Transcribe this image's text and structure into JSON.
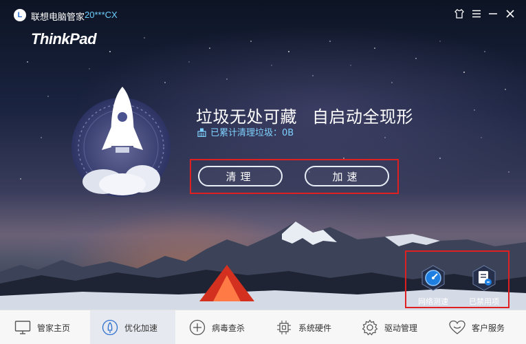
{
  "window": {
    "app_name": "联想电脑管家",
    "device_model": "20***CX",
    "brand": "ThinkPad",
    "logo_letter": "L",
    "controls": [
      "skin-icon",
      "menu-icon",
      "minimize-icon",
      "close-icon"
    ]
  },
  "hero": {
    "headline_part1": "垃圾无处可藏",
    "headline_part2": "自启动全现形",
    "status_text": "已累计清理垃圾：0B"
  },
  "actions": {
    "clean_label": "清理",
    "speedup_label": "加速"
  },
  "tools": [
    {
      "label": "网络测速",
      "icon": "speedometer-icon"
    },
    {
      "label": "已禁用项",
      "icon": "disabled-list-icon"
    }
  ],
  "nav": {
    "active_index": 1,
    "items": [
      {
        "label": "管家主页",
        "icon": "monitor-icon"
      },
      {
        "label": "优化加速",
        "icon": "rocket-icon"
      },
      {
        "label": "病毒查杀",
        "icon": "shield-icon"
      },
      {
        "label": "系统硬件",
        "icon": "chip-icon"
      },
      {
        "label": "驱动管理",
        "icon": "gear-icon"
      },
      {
        "label": "客户服务",
        "icon": "heart-icon"
      }
    ]
  },
  "colors": {
    "accent_cyan": "#6fd0ff",
    "highlight_red": "#e02020",
    "nav_bg": "#f7f7f7",
    "nav_active_bg": "#e6e9ef"
  }
}
